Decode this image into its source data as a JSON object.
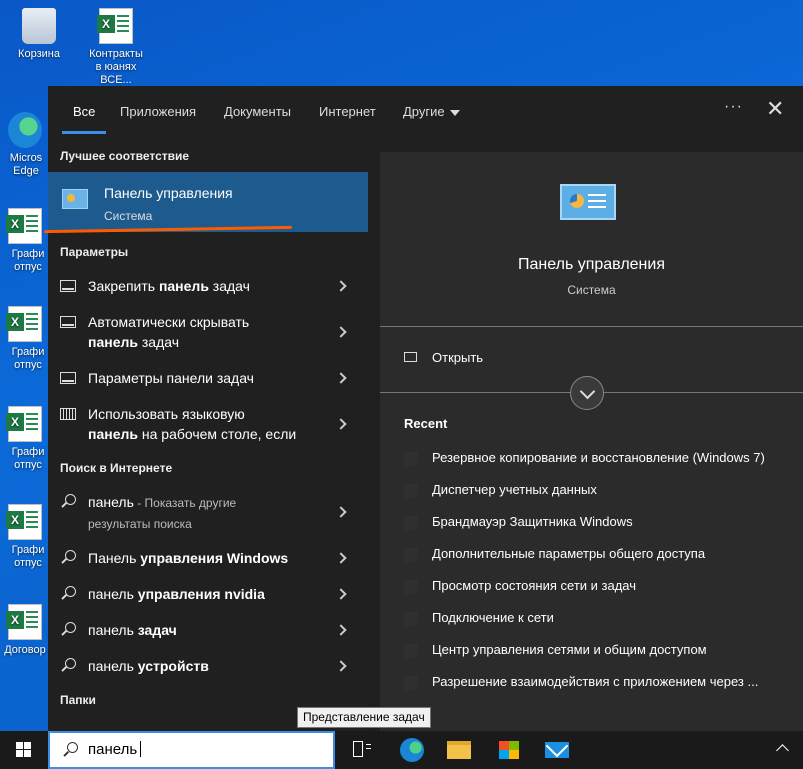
{
  "desktop": {
    "icons": [
      {
        "label": "Корзина",
        "icon": "recycle-bin-icon"
      },
      {
        "label": "Контракты в юанях ВСЕ...",
        "icon": "excel-file-icon"
      },
      {
        "label": "Micros Edge",
        "icon": "edge-icon"
      },
      {
        "label": "Графи отпус",
        "icon": "excel-file-icon"
      },
      {
        "label": "Графи отпус",
        "icon": "excel-file-icon"
      },
      {
        "label": "Графи отпус",
        "icon": "excel-file-icon"
      },
      {
        "label": "Графи отпус",
        "icon": "excel-file-icon"
      },
      {
        "label": "Договор",
        "icon": "excel-file-icon"
      }
    ]
  },
  "search_panel": {
    "tabs": [
      "Все",
      "Приложения",
      "Документы",
      "Интернет",
      "Другие"
    ],
    "active_tab": "Все",
    "more_label": "···",
    "close_label": "✕",
    "best_match": {
      "heading": "Лучшее соответствие",
      "title": "Панель управления",
      "subtitle": "Система"
    },
    "settings": {
      "heading": "Параметры",
      "items": [
        {
          "pre": "Закрепить ",
          "bold": "панель",
          "post": " задач"
        },
        {
          "pre": "Автоматически скрывать",
          "line2_bold": "панель",
          "line2_post": " задач"
        },
        {
          "pre": "Параметры панели задач"
        },
        {
          "pre": "Использовать языковую",
          "line2_bold": "панель",
          "line2_post": " на рабочем столе, если"
        }
      ]
    },
    "web": {
      "heading": "Поиск в Интернете",
      "items": [
        {
          "pre": "панель",
          "hint": " - Показать другие",
          "hint2": "результаты поиска"
        },
        {
          "pre": "Панель ",
          "bold": "управления Windows"
        },
        {
          "pre": "панель ",
          "bold": "управления nvidia"
        },
        {
          "pre": "панель ",
          "bold": "задач"
        },
        {
          "pre": "панель ",
          "bold": "устройств"
        }
      ]
    },
    "folders_heading": "Папки",
    "preview": {
      "title": "Панель управления",
      "subtitle": "Система",
      "open_label": "Открыть",
      "recent_heading": "Recent",
      "recent": [
        "Резервное копирование и восстановление (Windows 7)",
        "Диспетчер учетных данных",
        "Брандмауэр Защитника Windows",
        "Дополнительные параметры общего доступа",
        "Просмотр состояния сети и задач",
        "Подключение к сети",
        "Центр управления сетями и общим доступом",
        "Разрешение взаимодействия с приложением через ..."
      ]
    }
  },
  "tooltip": "Представление задач",
  "taskbar": {
    "search_value": "панель",
    "apps": [
      "task-view-icon",
      "edge-icon",
      "file-explorer-icon",
      "store-icon",
      "mail-icon"
    ]
  },
  "colors": {
    "accent": "#3d8ee8",
    "highlight": "#1d5b8e",
    "annotation": "#ff5a00"
  }
}
